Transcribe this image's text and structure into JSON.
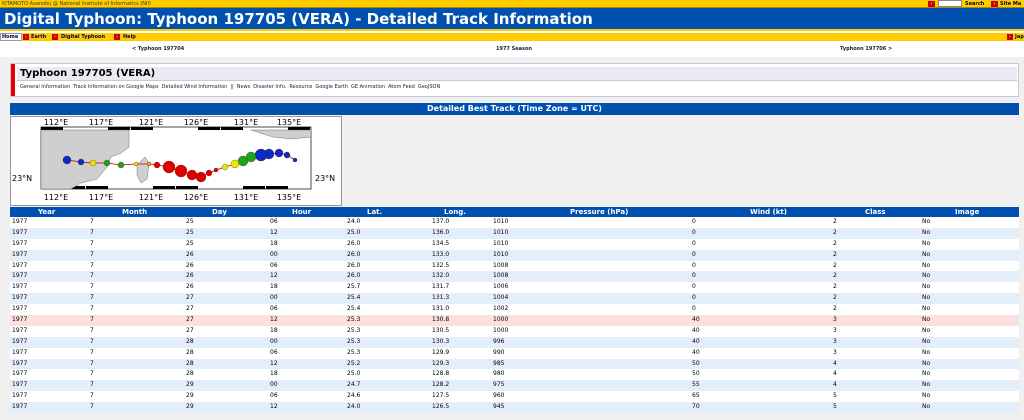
{
  "topbar": {
    "credit": "KITAMOTO Asanobu @ National Institute of Informatics (NII)",
    "search_label": "Search",
    "sitemap_label": "Site Ma"
  },
  "page_title": "Digital Typhoon: Typhoon 197705 (VERA) - Detailed Track Information",
  "nav": {
    "home": "Home",
    "earth": "Earth",
    "digital_typhoon": "Digital Typhoon",
    "help": "Help",
    "japanese": "Japane"
  },
  "season_nav": {
    "prev": "< Typhoon 197704",
    "season": "1977 Season",
    "next": "Typhoon 197706 >"
  },
  "typhoon_box": {
    "title": "Typhoon 197705 (VERA)",
    "links": [
      "General Information",
      "Track Information on Google Maps",
      "Detailed Wind Information",
      "||",
      "News",
      "Disaster Info.",
      "Resource",
      "Google Earth",
      "GE Animation",
      "Atom Feed",
      "GeoJSON"
    ]
  },
  "table_title": "Detailed Best Track (Time Zone = UTC)",
  "map": {
    "lon_labels": [
      "112°E",
      "117°E",
      "121°E",
      "126°E",
      "131°E",
      "135°E"
    ],
    "lat_label": "23°N"
  },
  "columns": [
    "Year",
    "Month",
    "Day",
    "Hour",
    "Lat.",
    "Long.",
    "Pressure (hPa)",
    "Wind (kt)",
    "Class",
    "Image"
  ],
  "rows": [
    [
      "1977",
      "7",
      "25",
      "06",
      "24.0",
      "137.0",
      "1010",
      "0",
      "2",
      "No"
    ],
    [
      "1977",
      "7",
      "25",
      "12",
      "25.0",
      "136.0",
      "1010",
      "0",
      "2",
      "No"
    ],
    [
      "1977",
      "7",
      "25",
      "18",
      "26.0",
      "134.5",
      "1010",
      "0",
      "2",
      "No"
    ],
    [
      "1977",
      "7",
      "26",
      "00",
      "26.0",
      "133.0",
      "1010",
      "0",
      "2",
      "No"
    ],
    [
      "1977",
      "7",
      "26",
      "06",
      "26.0",
      "132.5",
      "1008",
      "0",
      "2",
      "No"
    ],
    [
      "1977",
      "7",
      "26",
      "12",
      "26.0",
      "132.0",
      "1008",
      "0",
      "2",
      "No"
    ],
    [
      "1977",
      "7",
      "26",
      "18",
      "25.7",
      "131.7",
      "1006",
      "0",
      "2",
      "No"
    ],
    [
      "1977",
      "7",
      "27",
      "00",
      "25.4",
      "131.3",
      "1004",
      "0",
      "2",
      "No"
    ],
    [
      "1977",
      "7",
      "27",
      "06",
      "25.4",
      "131.0",
      "1002",
      "0",
      "2",
      "No"
    ],
    [
      "1977",
      "7",
      "27",
      "12",
      "25.3",
      "130.8",
      "1000",
      "40",
      "3",
      "No"
    ],
    [
      "1977",
      "7",
      "27",
      "18",
      "25.3",
      "130.5",
      "1000",
      "40",
      "3",
      "No"
    ],
    [
      "1977",
      "7",
      "28",
      "00",
      "25.3",
      "130.3",
      "996",
      "40",
      "3",
      "No"
    ],
    [
      "1977",
      "7",
      "28",
      "06",
      "25.3",
      "129.9",
      "990",
      "40",
      "3",
      "No"
    ],
    [
      "1977",
      "7",
      "28",
      "12",
      "25.2",
      "129.3",
      "985",
      "50",
      "4",
      "No"
    ],
    [
      "1977",
      "7",
      "28",
      "18",
      "25.0",
      "128.8",
      "980",
      "50",
      "4",
      "No"
    ],
    [
      "1977",
      "7",
      "29",
      "00",
      "24.7",
      "128.2",
      "975",
      "55",
      "4",
      "No"
    ],
    [
      "1977",
      "7",
      "29",
      "06",
      "24.6",
      "127.5",
      "960",
      "65",
      "5",
      "No"
    ],
    [
      "1977",
      "7",
      "29",
      "12",
      "24.0",
      "126.5",
      "945",
      "70",
      "5",
      "No"
    ]
  ],
  "highlight_row": 9
}
